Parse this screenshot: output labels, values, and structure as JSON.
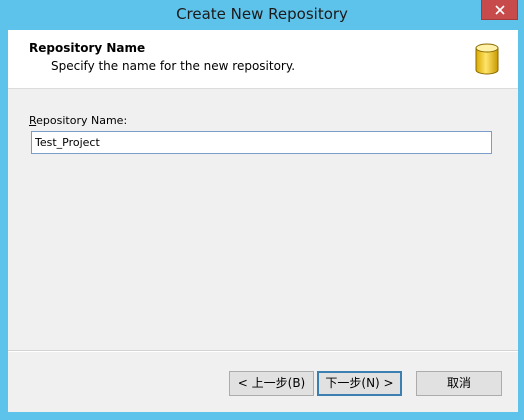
{
  "window": {
    "title": "Create New Repository"
  },
  "header": {
    "title": "Repository Name",
    "subtitle": "Specify the name for the new repository.",
    "icon": "database-icon"
  },
  "form": {
    "label_prefix": "R",
    "label_rest": "epository Name:",
    "value": "Test_Project"
  },
  "buttons": {
    "back": "< 上一步(B)",
    "next": "下一步(N) >",
    "cancel": "取消"
  },
  "colors": {
    "titlebar": "#5ec3ea",
    "close": "#c74b4b"
  }
}
